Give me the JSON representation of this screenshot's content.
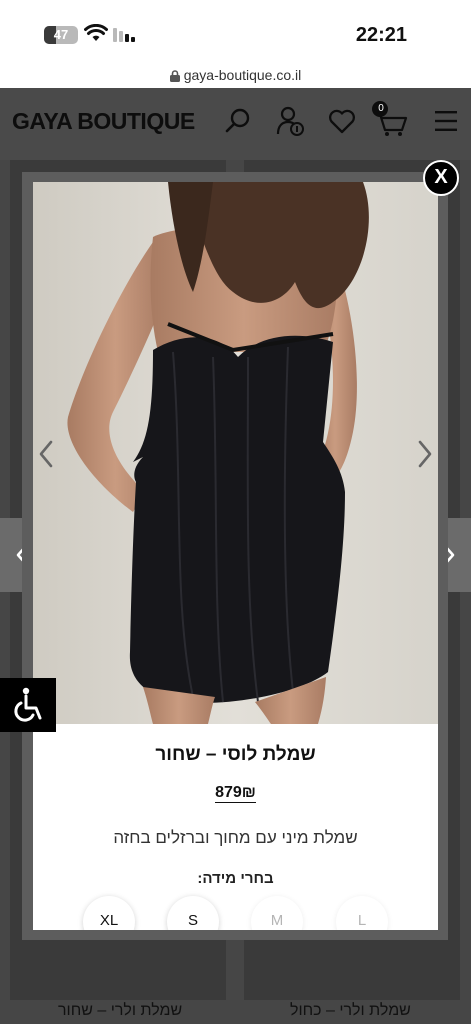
{
  "status_bar": {
    "battery": "47",
    "time": "22:21"
  },
  "browser": {
    "url": "gaya-boutique.co.il"
  },
  "header": {
    "brand": "GAYA BOUTIQUE",
    "cart_count": "0"
  },
  "modal": {
    "close_label": "X",
    "product_title": "שמלת לוסי – שחור",
    "price": "879₪",
    "description": "שמלת מיני עם מחוך וברזלים בחזה",
    "size_label": "בחרי מידה:",
    "sizes": [
      {
        "label": "XL",
        "available": true
      },
      {
        "label": "S",
        "available": true
      },
      {
        "label": "M",
        "available": false
      },
      {
        "label": "L",
        "available": false
      }
    ]
  },
  "background_products": [
    {
      "name": "שמלת ולרי – שחור"
    },
    {
      "name": "שמלת ולרי – כחול"
    }
  ],
  "colors": {
    "header_bg": "#4a4a4a",
    "overlay_bg": "#464646",
    "accent": "#000000"
  }
}
